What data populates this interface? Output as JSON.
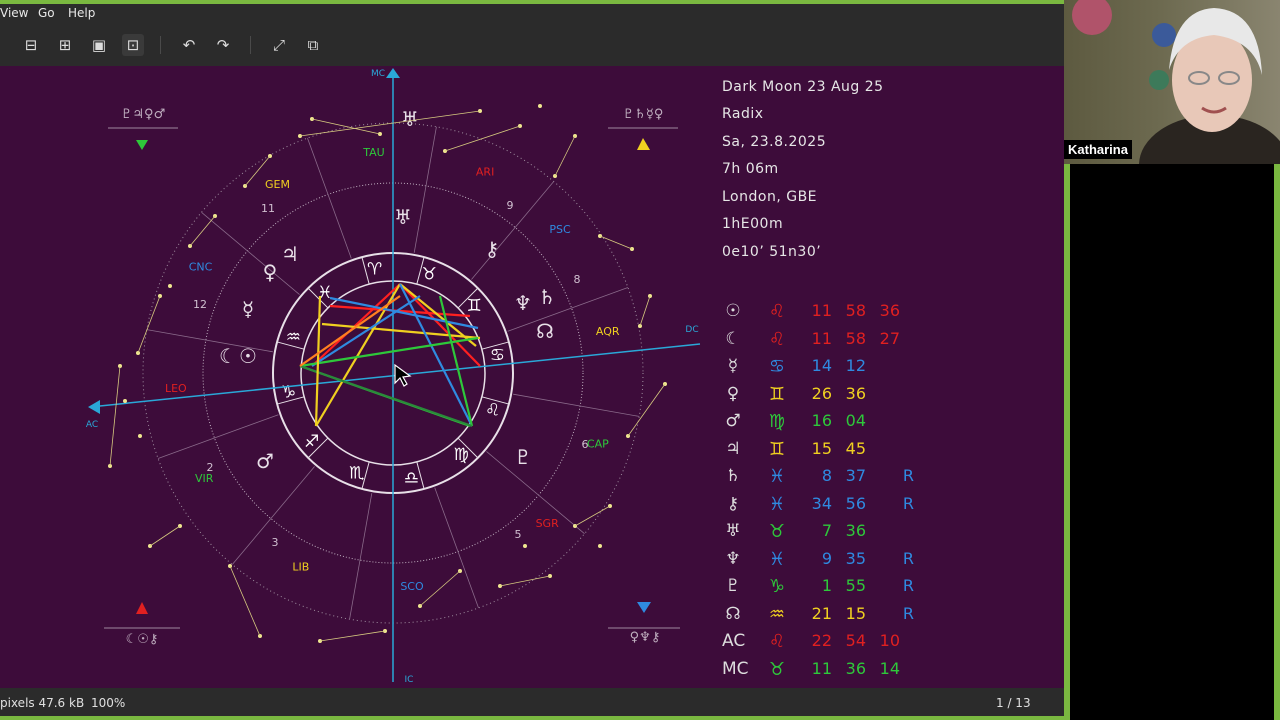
{
  "menu": {
    "view": "View",
    "go": "Go",
    "help": "Help"
  },
  "toolbar_icons": [
    "zoom-out-icon",
    "zoom-in-icon",
    "actual-size-icon",
    "best-fit-icon",
    "rotate-left-icon",
    "rotate-right-icon",
    "fullscreen-icon",
    "slideshow-icon"
  ],
  "status": {
    "pixels": "pixels 47.6 kB",
    "zoom": "100%",
    "page": "1 / 13"
  },
  "webcam": {
    "name": "Katharina"
  },
  "chart_info": {
    "title": "Dark Moon 23 Aug 25",
    "type": "Radix",
    "date": "Sa, 23.8.2025",
    "time": "7h 06m",
    "place": "London, GBE",
    "tz": "1hE00m",
    "coords": "0e10’   51n30’"
  },
  "positions": [
    {
      "planet": "☉",
      "sign": "♌",
      "color": "#e02020",
      "deg": "11",
      "min": "58",
      "sec": "36",
      "retro": ""
    },
    {
      "planet": "☾",
      "sign": "♌",
      "color": "#e02020",
      "deg": "11",
      "min": "58",
      "sec": "27",
      "retro": ""
    },
    {
      "planet": "☿",
      "sign": "♋",
      "color": "#2f8ae0",
      "deg": "14",
      "min": "12",
      "sec": "",
      "retro": ""
    },
    {
      "planet": "♀",
      "sign": "♊",
      "color": "#f0d020",
      "deg": "26",
      "min": "36",
      "sec": "",
      "retro": ""
    },
    {
      "planet": "♂",
      "sign": "♍",
      "color": "#2ec83a",
      "deg": "16",
      "min": "04",
      "sec": "",
      "retro": ""
    },
    {
      "planet": "♃",
      "sign": "♊",
      "color": "#f0d020",
      "deg": "15",
      "min": "45",
      "sec": "",
      "retro": ""
    },
    {
      "planet": "♄",
      "sign": "♓",
      "color": "#2f8ae0",
      "deg": "8",
      "min": "37",
      "sec": "",
      "retro": "R"
    },
    {
      "planet": "⚷",
      "sign": "♓",
      "color": "#2f8ae0",
      "deg": "34",
      "min": "56",
      "sec": "",
      "retro": "R"
    },
    {
      "planet": "♅",
      "sign": "♉",
      "color": "#2ec83a",
      "deg": "7",
      "min": "36",
      "sec": "",
      "retro": ""
    },
    {
      "planet": "♆",
      "sign": "♓",
      "color": "#2f8ae0",
      "deg": "9",
      "min": "35",
      "sec": "",
      "retro": "R"
    },
    {
      "planet": "♇",
      "sign": "♑",
      "color": "#2ec83a",
      "deg": "1",
      "min": "55",
      "sec": "",
      "retro": "R"
    },
    {
      "planet": "☊",
      "sign": "♒",
      "color": "#f0d020",
      "deg": "21",
      "min": "15",
      "sec": "",
      "retro": "R"
    },
    {
      "planet": "AC",
      "sign": "♌",
      "color": "#e02020",
      "deg": "22",
      "min": "54",
      "sec": "10",
      "retro": ""
    },
    {
      "planet": "MC",
      "sign": "♉",
      "color": "#2ec83a",
      "deg": "11",
      "min": "36",
      "sec": "14",
      "retro": ""
    }
  ],
  "wheel": {
    "axis_labels": {
      "mc": "MC",
      "ic": "IC",
      "ac": "AC",
      "dc": "DC"
    },
    "constellations": [
      "TAU",
      "ARI",
      "PSC",
      "AQR",
      "CAP",
      "SGR",
      "SCO",
      "LIB",
      "VIR",
      "LEO",
      "CNC",
      "GEM"
    ],
    "house_numbers": [
      "11",
      "9",
      "8",
      "12",
      "2",
      "3",
      "5",
      "6"
    ],
    "corner_glyphs": {
      "top_left": "♇♃♀♂",
      "top_right": "♇♄☿♀",
      "bottom_left": "☾☉⚷",
      "bottom_right": "♀♆⚷"
    },
    "zodiac_ring": [
      "♈",
      "♉",
      "♊",
      "♋",
      "♌",
      "♍",
      "♎",
      "♏",
      "♐",
      "♑",
      "♒",
      "♓"
    ]
  }
}
